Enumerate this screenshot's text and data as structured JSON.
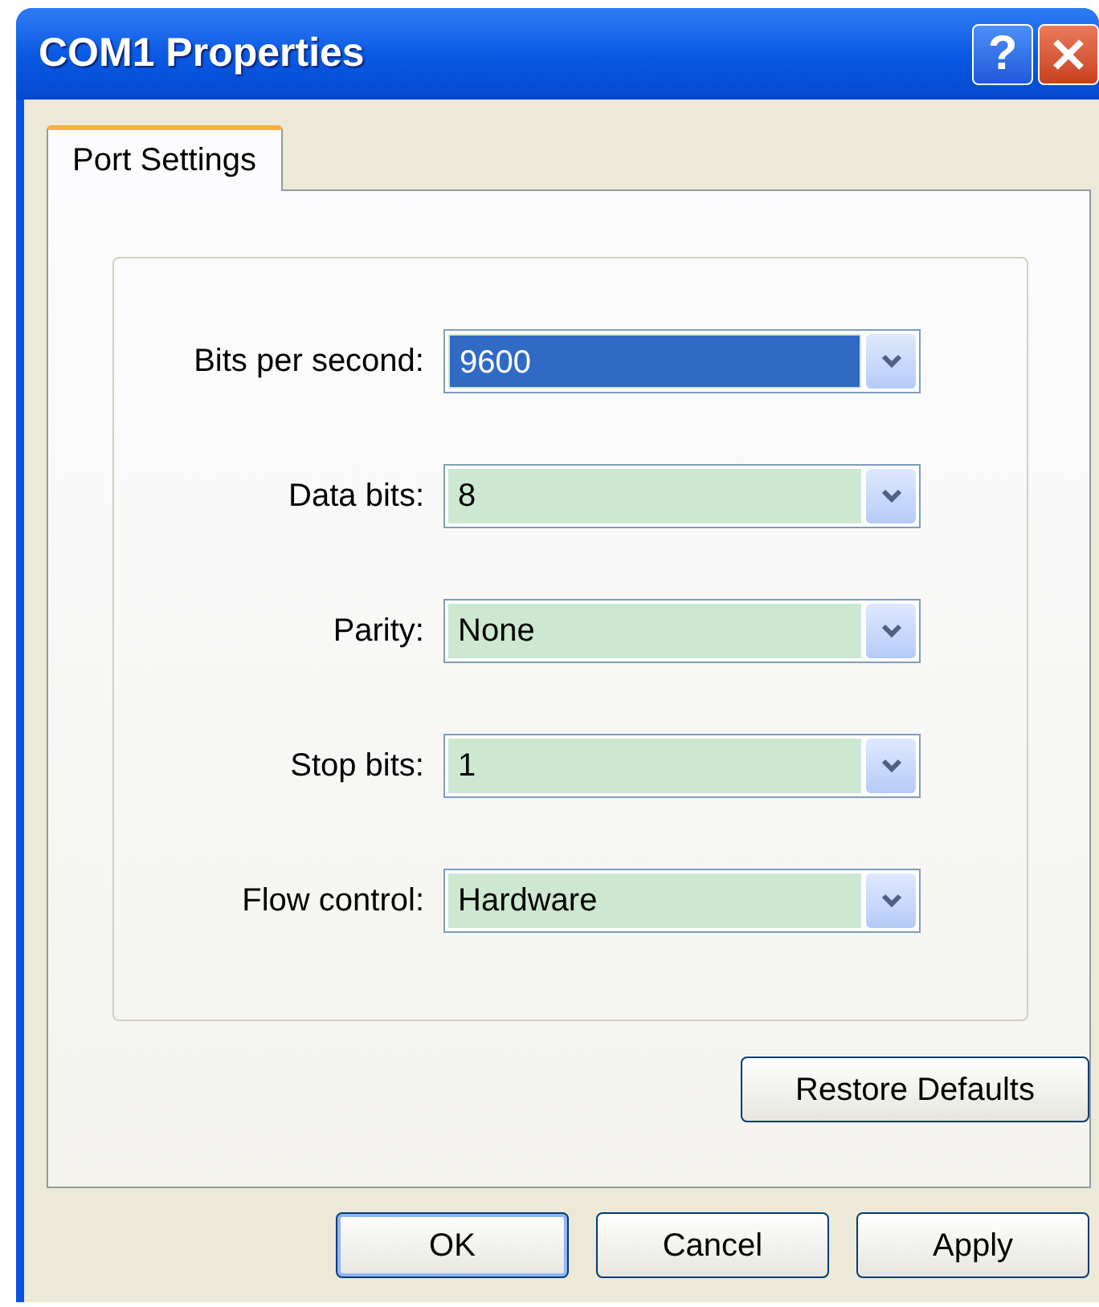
{
  "window": {
    "title": "COM1 Properties",
    "title_buttons": [
      {
        "kind": "help",
        "label": "?"
      },
      {
        "kind": "close"
      }
    ]
  },
  "tabs": [
    {
      "label": "Port Settings",
      "selected": true
    }
  ],
  "settings": [
    {
      "label": "Bits per second:",
      "value": "9600",
      "focused": true
    },
    {
      "label": "Data bits:",
      "value": "8",
      "focused": false
    },
    {
      "label": "Parity:",
      "value": "None",
      "focused": false
    },
    {
      "label": "Stop bits:",
      "value": "1",
      "focused": false
    },
    {
      "label": "Flow control:",
      "value": "Hardware",
      "focused": false
    }
  ],
  "restore_button": "Restore Defaults",
  "buttons": [
    {
      "label": "OK",
      "default": true
    },
    {
      "label": "Cancel",
      "default": false
    },
    {
      "label": "Apply",
      "default": false
    }
  ]
}
